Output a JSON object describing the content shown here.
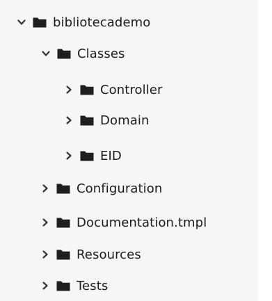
{
  "tree": {
    "root": {
      "label": "bibliotecademo",
      "state": "expanded"
    },
    "classes": {
      "label": "Classes",
      "state": "expanded"
    },
    "controller": {
      "label": "Controller",
      "state": "collapsed"
    },
    "domain": {
      "label": "Domain",
      "state": "collapsed"
    },
    "eid": {
      "label": "EID",
      "state": "collapsed"
    },
    "configuration": {
      "label": "Configuration",
      "state": "collapsed"
    },
    "documentation": {
      "label": "Documentation.tmpl",
      "state": "collapsed"
    },
    "resources": {
      "label": "Resources",
      "state": "collapsed"
    },
    "tests": {
      "label": "Tests",
      "state": "collapsed"
    }
  },
  "icons": {
    "folder": "folder-icon",
    "expanded": "chevron-down-icon",
    "collapsed": "chevron-right-icon"
  },
  "colors": {
    "panel_background": "#f6f6f6",
    "folder_fill": "#1e1e1e",
    "text": "#1b1b1b",
    "chevron": "#333333"
  }
}
